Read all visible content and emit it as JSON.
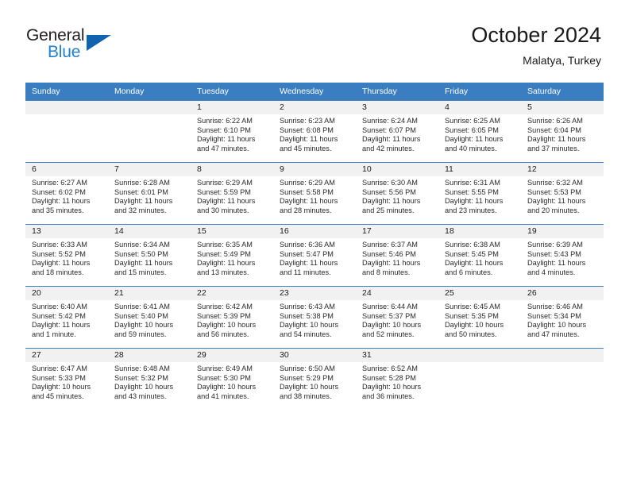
{
  "brand": {
    "name_part1": "General",
    "name_part2": "Blue",
    "logo_icon": "triangle-logo-icon",
    "accent_color": "#1163b0",
    "blue_text_color": "#1f7fd4"
  },
  "header": {
    "title": "October 2024",
    "subtitle": "Malatya, Turkey"
  },
  "calendar": {
    "header_bg": "#3a7ec1",
    "daynum_bg": "#f1f1f1",
    "weekdays": [
      "Sunday",
      "Monday",
      "Tuesday",
      "Wednesday",
      "Thursday",
      "Friday",
      "Saturday"
    ],
    "weeks": [
      [
        {
          "day": "",
          "sunrise": "",
          "sunset": "",
          "daylight_line1": "",
          "daylight_line2": ""
        },
        {
          "day": "",
          "sunrise": "",
          "sunset": "",
          "daylight_line1": "",
          "daylight_line2": ""
        },
        {
          "day": "1",
          "sunrise": "Sunrise: 6:22 AM",
          "sunset": "Sunset: 6:10 PM",
          "daylight_line1": "Daylight: 11 hours",
          "daylight_line2": "and 47 minutes."
        },
        {
          "day": "2",
          "sunrise": "Sunrise: 6:23 AM",
          "sunset": "Sunset: 6:08 PM",
          "daylight_line1": "Daylight: 11 hours",
          "daylight_line2": "and 45 minutes."
        },
        {
          "day": "3",
          "sunrise": "Sunrise: 6:24 AM",
          "sunset": "Sunset: 6:07 PM",
          "daylight_line1": "Daylight: 11 hours",
          "daylight_line2": "and 42 minutes."
        },
        {
          "day": "4",
          "sunrise": "Sunrise: 6:25 AM",
          "sunset": "Sunset: 6:05 PM",
          "daylight_line1": "Daylight: 11 hours",
          "daylight_line2": "and 40 minutes."
        },
        {
          "day": "5",
          "sunrise": "Sunrise: 6:26 AM",
          "sunset": "Sunset: 6:04 PM",
          "daylight_line1": "Daylight: 11 hours",
          "daylight_line2": "and 37 minutes."
        }
      ],
      [
        {
          "day": "6",
          "sunrise": "Sunrise: 6:27 AM",
          "sunset": "Sunset: 6:02 PM",
          "daylight_line1": "Daylight: 11 hours",
          "daylight_line2": "and 35 minutes."
        },
        {
          "day": "7",
          "sunrise": "Sunrise: 6:28 AM",
          "sunset": "Sunset: 6:01 PM",
          "daylight_line1": "Daylight: 11 hours",
          "daylight_line2": "and 32 minutes."
        },
        {
          "day": "8",
          "sunrise": "Sunrise: 6:29 AM",
          "sunset": "Sunset: 5:59 PM",
          "daylight_line1": "Daylight: 11 hours",
          "daylight_line2": "and 30 minutes."
        },
        {
          "day": "9",
          "sunrise": "Sunrise: 6:29 AM",
          "sunset": "Sunset: 5:58 PM",
          "daylight_line1": "Daylight: 11 hours",
          "daylight_line2": "and 28 minutes."
        },
        {
          "day": "10",
          "sunrise": "Sunrise: 6:30 AM",
          "sunset": "Sunset: 5:56 PM",
          "daylight_line1": "Daylight: 11 hours",
          "daylight_line2": "and 25 minutes."
        },
        {
          "day": "11",
          "sunrise": "Sunrise: 6:31 AM",
          "sunset": "Sunset: 5:55 PM",
          "daylight_line1": "Daylight: 11 hours",
          "daylight_line2": "and 23 minutes."
        },
        {
          "day": "12",
          "sunrise": "Sunrise: 6:32 AM",
          "sunset": "Sunset: 5:53 PM",
          "daylight_line1": "Daylight: 11 hours",
          "daylight_line2": "and 20 minutes."
        }
      ],
      [
        {
          "day": "13",
          "sunrise": "Sunrise: 6:33 AM",
          "sunset": "Sunset: 5:52 PM",
          "daylight_line1": "Daylight: 11 hours",
          "daylight_line2": "and 18 minutes."
        },
        {
          "day": "14",
          "sunrise": "Sunrise: 6:34 AM",
          "sunset": "Sunset: 5:50 PM",
          "daylight_line1": "Daylight: 11 hours",
          "daylight_line2": "and 15 minutes."
        },
        {
          "day": "15",
          "sunrise": "Sunrise: 6:35 AM",
          "sunset": "Sunset: 5:49 PM",
          "daylight_line1": "Daylight: 11 hours",
          "daylight_line2": "and 13 minutes."
        },
        {
          "day": "16",
          "sunrise": "Sunrise: 6:36 AM",
          "sunset": "Sunset: 5:47 PM",
          "daylight_line1": "Daylight: 11 hours",
          "daylight_line2": "and 11 minutes."
        },
        {
          "day": "17",
          "sunrise": "Sunrise: 6:37 AM",
          "sunset": "Sunset: 5:46 PM",
          "daylight_line1": "Daylight: 11 hours",
          "daylight_line2": "and 8 minutes."
        },
        {
          "day": "18",
          "sunrise": "Sunrise: 6:38 AM",
          "sunset": "Sunset: 5:45 PM",
          "daylight_line1": "Daylight: 11 hours",
          "daylight_line2": "and 6 minutes."
        },
        {
          "day": "19",
          "sunrise": "Sunrise: 6:39 AM",
          "sunset": "Sunset: 5:43 PM",
          "daylight_line1": "Daylight: 11 hours",
          "daylight_line2": "and 4 minutes."
        }
      ],
      [
        {
          "day": "20",
          "sunrise": "Sunrise: 6:40 AM",
          "sunset": "Sunset: 5:42 PM",
          "daylight_line1": "Daylight: 11 hours",
          "daylight_line2": "and 1 minute."
        },
        {
          "day": "21",
          "sunrise": "Sunrise: 6:41 AM",
          "sunset": "Sunset: 5:40 PM",
          "daylight_line1": "Daylight: 10 hours",
          "daylight_line2": "and 59 minutes."
        },
        {
          "day": "22",
          "sunrise": "Sunrise: 6:42 AM",
          "sunset": "Sunset: 5:39 PM",
          "daylight_line1": "Daylight: 10 hours",
          "daylight_line2": "and 56 minutes."
        },
        {
          "day": "23",
          "sunrise": "Sunrise: 6:43 AM",
          "sunset": "Sunset: 5:38 PM",
          "daylight_line1": "Daylight: 10 hours",
          "daylight_line2": "and 54 minutes."
        },
        {
          "day": "24",
          "sunrise": "Sunrise: 6:44 AM",
          "sunset": "Sunset: 5:37 PM",
          "daylight_line1": "Daylight: 10 hours",
          "daylight_line2": "and 52 minutes."
        },
        {
          "day": "25",
          "sunrise": "Sunrise: 6:45 AM",
          "sunset": "Sunset: 5:35 PM",
          "daylight_line1": "Daylight: 10 hours",
          "daylight_line2": "and 50 minutes."
        },
        {
          "day": "26",
          "sunrise": "Sunrise: 6:46 AM",
          "sunset": "Sunset: 5:34 PM",
          "daylight_line1": "Daylight: 10 hours",
          "daylight_line2": "and 47 minutes."
        }
      ],
      [
        {
          "day": "27",
          "sunrise": "Sunrise: 6:47 AM",
          "sunset": "Sunset: 5:33 PM",
          "daylight_line1": "Daylight: 10 hours",
          "daylight_line2": "and 45 minutes."
        },
        {
          "day": "28",
          "sunrise": "Sunrise: 6:48 AM",
          "sunset": "Sunset: 5:32 PM",
          "daylight_line1": "Daylight: 10 hours",
          "daylight_line2": "and 43 minutes."
        },
        {
          "day": "29",
          "sunrise": "Sunrise: 6:49 AM",
          "sunset": "Sunset: 5:30 PM",
          "daylight_line1": "Daylight: 10 hours",
          "daylight_line2": "and 41 minutes."
        },
        {
          "day": "30",
          "sunrise": "Sunrise: 6:50 AM",
          "sunset": "Sunset: 5:29 PM",
          "daylight_line1": "Daylight: 10 hours",
          "daylight_line2": "and 38 minutes."
        },
        {
          "day": "31",
          "sunrise": "Sunrise: 6:52 AM",
          "sunset": "Sunset: 5:28 PM",
          "daylight_line1": "Daylight: 10 hours",
          "daylight_line2": "and 36 minutes."
        },
        {
          "day": "",
          "sunrise": "",
          "sunset": "",
          "daylight_line1": "",
          "daylight_line2": ""
        },
        {
          "day": "",
          "sunrise": "",
          "sunset": "",
          "daylight_line1": "",
          "daylight_line2": ""
        }
      ]
    ]
  }
}
